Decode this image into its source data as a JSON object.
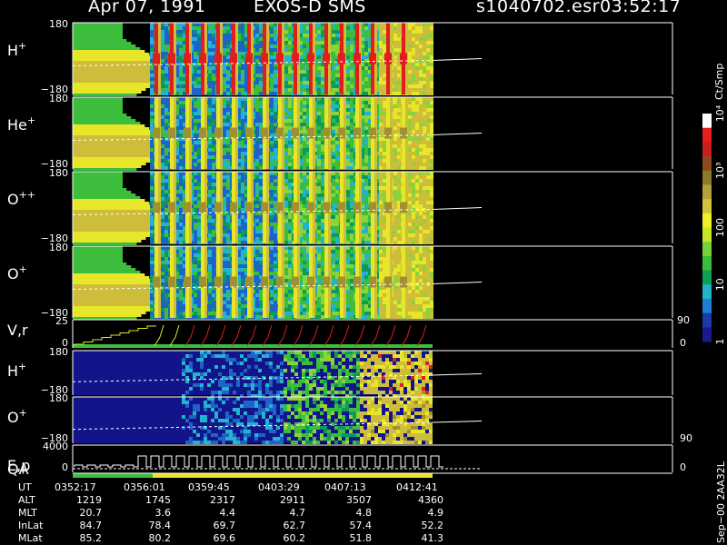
{
  "header": {
    "date": "Apr 07, 1991",
    "instrument": "EXOS-D SMS",
    "file": "s1040702.esr",
    "time": "03:52:17"
  },
  "colorbar": {
    "unit": "Ct/Smp",
    "ticks": [
      {
        "label": "1",
        "value": 1
      },
      {
        "label": "10",
        "value": 10
      },
      {
        "label": "100",
        "value": 100
      },
      {
        "label": "10³",
        "value": 1000
      },
      {
        "label": "10⁴",
        "value": 10000
      }
    ],
    "colors": [
      "#1a1a8c",
      "#1a3aa6",
      "#1e7fd0",
      "#21b4c8",
      "#10a050",
      "#3cbe3c",
      "#7ad23a",
      "#c8e628",
      "#f0f028",
      "#d2c23c",
      "#b4a03c",
      "#8c7a28",
      "#8c4a1e",
      "#c81e1e",
      "#e61e1e",
      "#ffffff"
    ]
  },
  "panels": [
    {
      "label": "H",
      "sup": "+",
      "ytop": "180",
      "ybot": "−180"
    },
    {
      "label": "He",
      "sup": "+",
      "ytop": "180",
      "ybot": "−180"
    },
    {
      "label": "O",
      "sup": "++",
      "ytop": "180",
      "ybot": "−180"
    },
    {
      "label": "O",
      "sup": "+",
      "ytop": "180",
      "ybot": "−180"
    },
    {
      "label": "V,r",
      "sup": "",
      "ytop": "25",
      "ybot": "0",
      "right_top": "90",
      "right_bot": "0"
    },
    {
      "label": "H",
      "sup": "+",
      "ytop": "180",
      "ybot": "−180"
    },
    {
      "label": "O",
      "sup": "+",
      "ytop": "180",
      "ybot": "−180",
      "right_bot": "90"
    },
    {
      "label": "E,p",
      "label2": "QA",
      "sup": "",
      "ytop": "4000",
      "ybot": "0",
      "right_bot": "0"
    }
  ],
  "footer_label": "Sep−00 2AA32L",
  "table": {
    "rows": [
      {
        "name": "UT",
        "values": [
          "0352:17",
          "0356:01",
          "0359:45",
          "0403:29",
          "0407:13",
          "0412:41"
        ]
      },
      {
        "name": "ALT",
        "values": [
          "1219",
          "1745",
          "2317",
          "2911",
          "3507",
          "4360"
        ]
      },
      {
        "name": "MLT",
        "values": [
          "20.7",
          "3.6",
          "4.4",
          "4.7",
          "4.8",
          "4.9"
        ]
      },
      {
        "name": "InLat",
        "values": [
          "84.7",
          "78.4",
          "69.7",
          "62.7",
          "57.4",
          "52.2"
        ]
      },
      {
        "name": "MLat",
        "values": [
          "85.2",
          "80.2",
          "69.6",
          "60.2",
          "51.8",
          "41.3"
        ]
      }
    ]
  },
  "chart_data": {
    "type": "heatmap",
    "title": "Apr 07, 1991 EXOS-D SMS",
    "time_axis": [
      "0352:17",
      "0356:01",
      "0359:45",
      "0403:29",
      "0407:13",
      "0412:41"
    ],
    "colorbar_range": [
      1,
      10000
    ],
    "colorbar_scale": "log",
    "series": [
      {
        "name": "H+",
        "ylim": [
          -180,
          180
        ]
      },
      {
        "name": "He+",
        "ylim": [
          -180,
          180
        ]
      },
      {
        "name": "O++",
        "ylim": [
          -180,
          180
        ]
      },
      {
        "name": "O+",
        "ylim": [
          -180,
          180
        ]
      },
      {
        "name": "V,r",
        "ylim": [
          0,
          25
        ]
      },
      {
        "name": "H+",
        "ylim": [
          -180,
          180
        ]
      },
      {
        "name": "O+",
        "ylim": [
          -180,
          180
        ]
      },
      {
        "name": "E,p",
        "ylim": [
          0,
          4000
        ]
      }
    ]
  }
}
